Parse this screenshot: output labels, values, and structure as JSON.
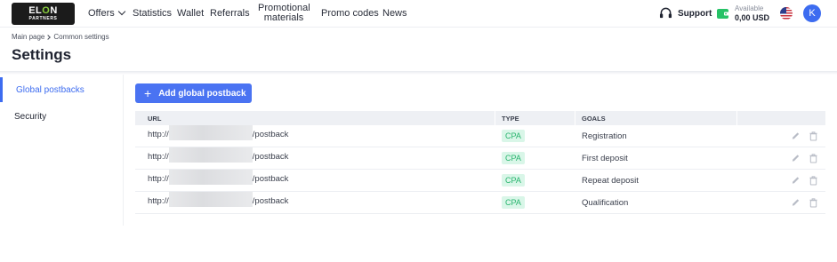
{
  "app": {
    "logo_text_main_1": "EL",
    "logo_text_main_2": "O",
    "logo_text_main_3": "N",
    "logo_text_sub": "PARTNERS",
    "accent_color": "#3d6cf0"
  },
  "nav": {
    "offers": "Offers",
    "statistics": "Statistics",
    "wallet": "Wallet",
    "referrals": "Referrals",
    "promotional_line1": "Promotional",
    "promotional_line2": "materials",
    "promo_codes": "Promo codes",
    "news": "News"
  },
  "header_right": {
    "support_label": "Support",
    "balance_label": "Available",
    "balance_value": "0,00 USD",
    "language_icon": "us-flag-icon",
    "avatar_letter": "K"
  },
  "breadcrumb": {
    "root": "Main page",
    "current": "Common settings"
  },
  "page_title": "Settings",
  "sidebar": {
    "items": [
      {
        "label": "Global postbacks",
        "active": true
      },
      {
        "label": "Security",
        "active": false
      }
    ]
  },
  "main": {
    "add_button_label": "Add global postback",
    "table": {
      "headers": {
        "url": "URL",
        "type": "TYPE",
        "goals": "GOALS"
      },
      "rows": [
        {
          "url_prefix": "http://",
          "url_suffix": "/postback",
          "type": "CPA",
          "goal": "Registration"
        },
        {
          "url_prefix": "http://",
          "url_suffix": "/postback",
          "type": "CPA",
          "goal": "First deposit"
        },
        {
          "url_prefix": "http://",
          "url_suffix": "/postback",
          "type": "CPA",
          "goal": "Repeat deposit"
        },
        {
          "url_prefix": "http://",
          "url_suffix": "/postback",
          "type": "CPA",
          "goal": "Qualification"
        }
      ]
    }
  }
}
